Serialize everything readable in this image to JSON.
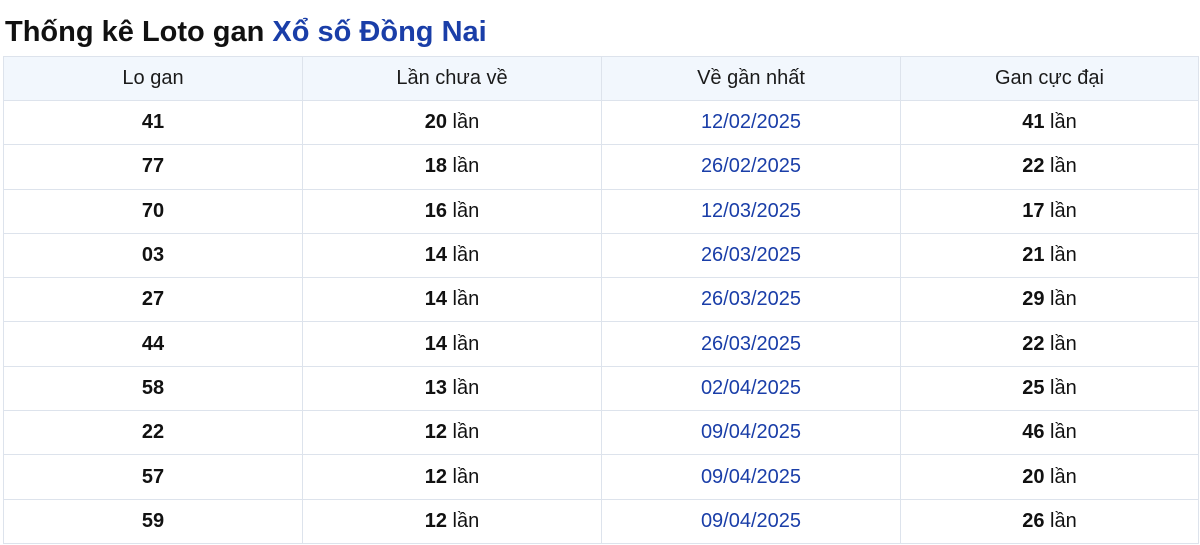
{
  "title": {
    "prefix": "Thống kê Loto gan",
    "highlight": "Xổ số Đồng Nai"
  },
  "colors": {
    "accent": "#1a3ea8",
    "header_bg": "#f2f7fd",
    "border": "#dde3ec"
  },
  "table": {
    "headers": [
      "Lo gan",
      "Lần chưa về",
      "Về gần nhất",
      "Gan cực đại"
    ],
    "unit": "lần",
    "rows": [
      {
        "lo": "41",
        "missing": "20",
        "last_date": "12/02/2025",
        "max_gap": "41"
      },
      {
        "lo": "77",
        "missing": "18",
        "last_date": "26/02/2025",
        "max_gap": "22"
      },
      {
        "lo": "70",
        "missing": "16",
        "last_date": "12/03/2025",
        "max_gap": "17"
      },
      {
        "lo": "03",
        "missing": "14",
        "last_date": "26/03/2025",
        "max_gap": "21"
      },
      {
        "lo": "27",
        "missing": "14",
        "last_date": "26/03/2025",
        "max_gap": "29"
      },
      {
        "lo": "44",
        "missing": "14",
        "last_date": "26/03/2025",
        "max_gap": "22"
      },
      {
        "lo": "58",
        "missing": "13",
        "last_date": "02/04/2025",
        "max_gap": "25"
      },
      {
        "lo": "22",
        "missing": "12",
        "last_date": "09/04/2025",
        "max_gap": "46"
      },
      {
        "lo": "57",
        "missing": "12",
        "last_date": "09/04/2025",
        "max_gap": "20"
      },
      {
        "lo": "59",
        "missing": "12",
        "last_date": "09/04/2025",
        "max_gap": "26"
      }
    ]
  }
}
